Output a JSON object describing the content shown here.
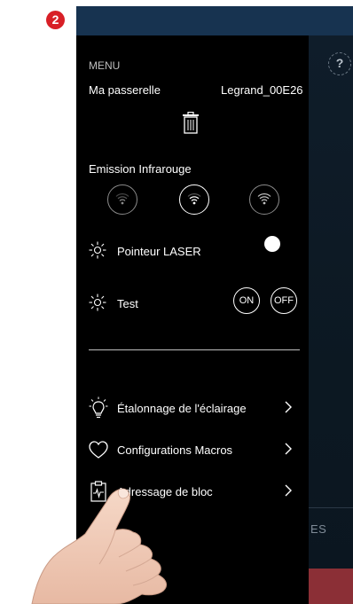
{
  "step_badge": "2",
  "background_app": {
    "help_icon": "?",
    "tab_text": "ES"
  },
  "drawer": {
    "menu_header": "MENU",
    "gateway_label": "Ma passerelle",
    "gateway_value": "Legrand_00E26",
    "delete_icon": "trash-icon",
    "ir_section_label": "Emission Infrarouge",
    "ir_levels": [
      "low",
      "medium",
      "high"
    ],
    "ir_selected_index": 1,
    "laser_label": "Pointeur LASER",
    "laser_enabled": true,
    "test_label": "Test",
    "test_on_label": "ON",
    "test_off_label": "OFF",
    "items": [
      {
        "label": "Étalonnage de l'éclairage",
        "icon": "lightbulb-icon"
      },
      {
        "label": "Configurations Macros",
        "icon": "heart-icon"
      },
      {
        "label": "Adressage de bloc",
        "icon": "clipboard-pulse-icon"
      }
    ]
  },
  "colors": {
    "badge": "#d81f26",
    "status_bar": "#173350",
    "drawer_bg": "#000000",
    "accent_red": "#8b2f36"
  }
}
